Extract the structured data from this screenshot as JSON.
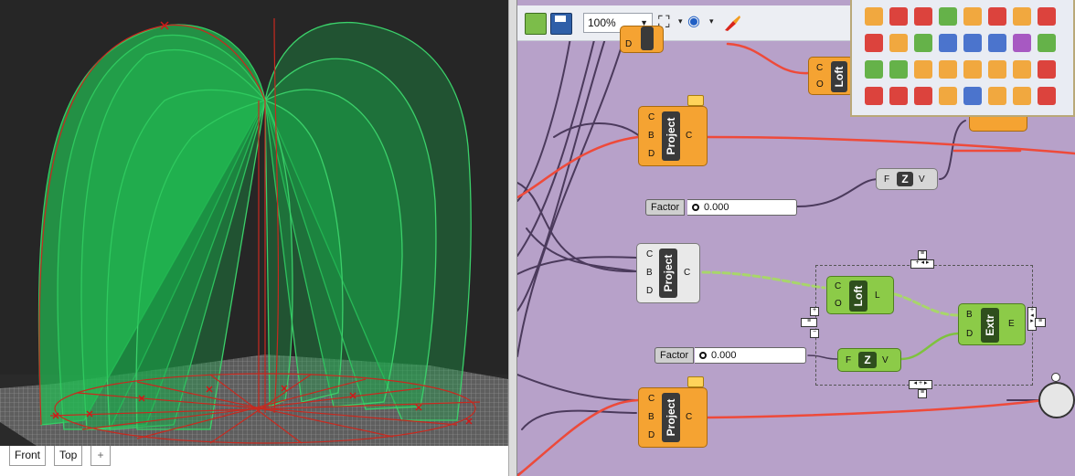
{
  "viewport": {
    "tabs": [
      "Front",
      "Top"
    ],
    "add_tab_label": "+"
  },
  "toolbar": {
    "zoom": "100%",
    "open_icon": "open-file-icon",
    "save_icon": "save-icon",
    "zoom_extents_icon": "zoom-extents-icon",
    "preview_icon": "eye-icon",
    "paint_icon": "paint-brush-icon"
  },
  "components": {
    "loft_top": {
      "nick": "Loft",
      "inputs": [
        "C",
        "O"
      ]
    },
    "project_1": {
      "nick": "Project",
      "inputs": [
        "C",
        "B",
        "D"
      ],
      "output": "C"
    },
    "project_top": {
      "inputs": [
        "D"
      ]
    },
    "unit_z_top": {
      "nick": "Z",
      "input": "F",
      "output": "V"
    },
    "slider_1": {
      "label": "Factor",
      "value": "0.000"
    },
    "project_2": {
      "nick": "Project",
      "inputs": [
        "C",
        "B",
        "D"
      ],
      "output": "C"
    },
    "loft_green": {
      "nick": "Loft",
      "inputs": [
        "C",
        "O"
      ],
      "output": "L"
    },
    "extr_green": {
      "nick": "Extr",
      "inputs": [
        "B",
        "D"
      ],
      "output": "E"
    },
    "slider_2": {
      "label": "Factor",
      "value": "0.000"
    },
    "unit_z_green": {
      "nick": "Z",
      "input": "F",
      "output": "V"
    },
    "project_3": {
      "nick": "Project",
      "inputs": [
        "C",
        "B",
        "D"
      ],
      "output": "C"
    }
  },
  "palette": {
    "rows": [
      [
        "number-label-icon",
        "plane-icon",
        "polyline-icon",
        "sphere-point-icon",
        "pipe-icon",
        "mesh-icon",
        "tree-icon",
        "text-tag-icon"
      ],
      [
        "box-red-icon",
        "box-3d-icon",
        "gear-mesh-icon",
        "wire-sphere-icon",
        "grid-surface-icon",
        "blue-mesh-icon",
        "flower-icon",
        "cube-green-icon"
      ],
      [
        "terrain-icon",
        "grid-number-icon",
        "rings-icon",
        "bars-icon",
        "fractal-icon",
        "sphere-orange-icon",
        "cube-orange-icon",
        "tower-icon"
      ],
      [
        "delete-grid-icon",
        "delete-pattern-icon",
        "scatter-delete-icon",
        "stack-icon",
        "move-corner-icon",
        "move-down-icon",
        "pen-icon",
        "arrow-box-icon"
      ]
    ],
    "colors": {
      "red": "#d9261c",
      "orange": "#f29c1f",
      "green": "#4ea82a",
      "blue": "#2f5fc6",
      "purple": "#9b3fb8"
    }
  },
  "colors": {
    "canvas": "#b7a1c9",
    "component_orange": "#f5a332",
    "component_green": "#8ccb48",
    "wire_red": "#ee4a3a",
    "wire_dark": "#4b3a5c",
    "surface_green": "#1aa84a"
  }
}
